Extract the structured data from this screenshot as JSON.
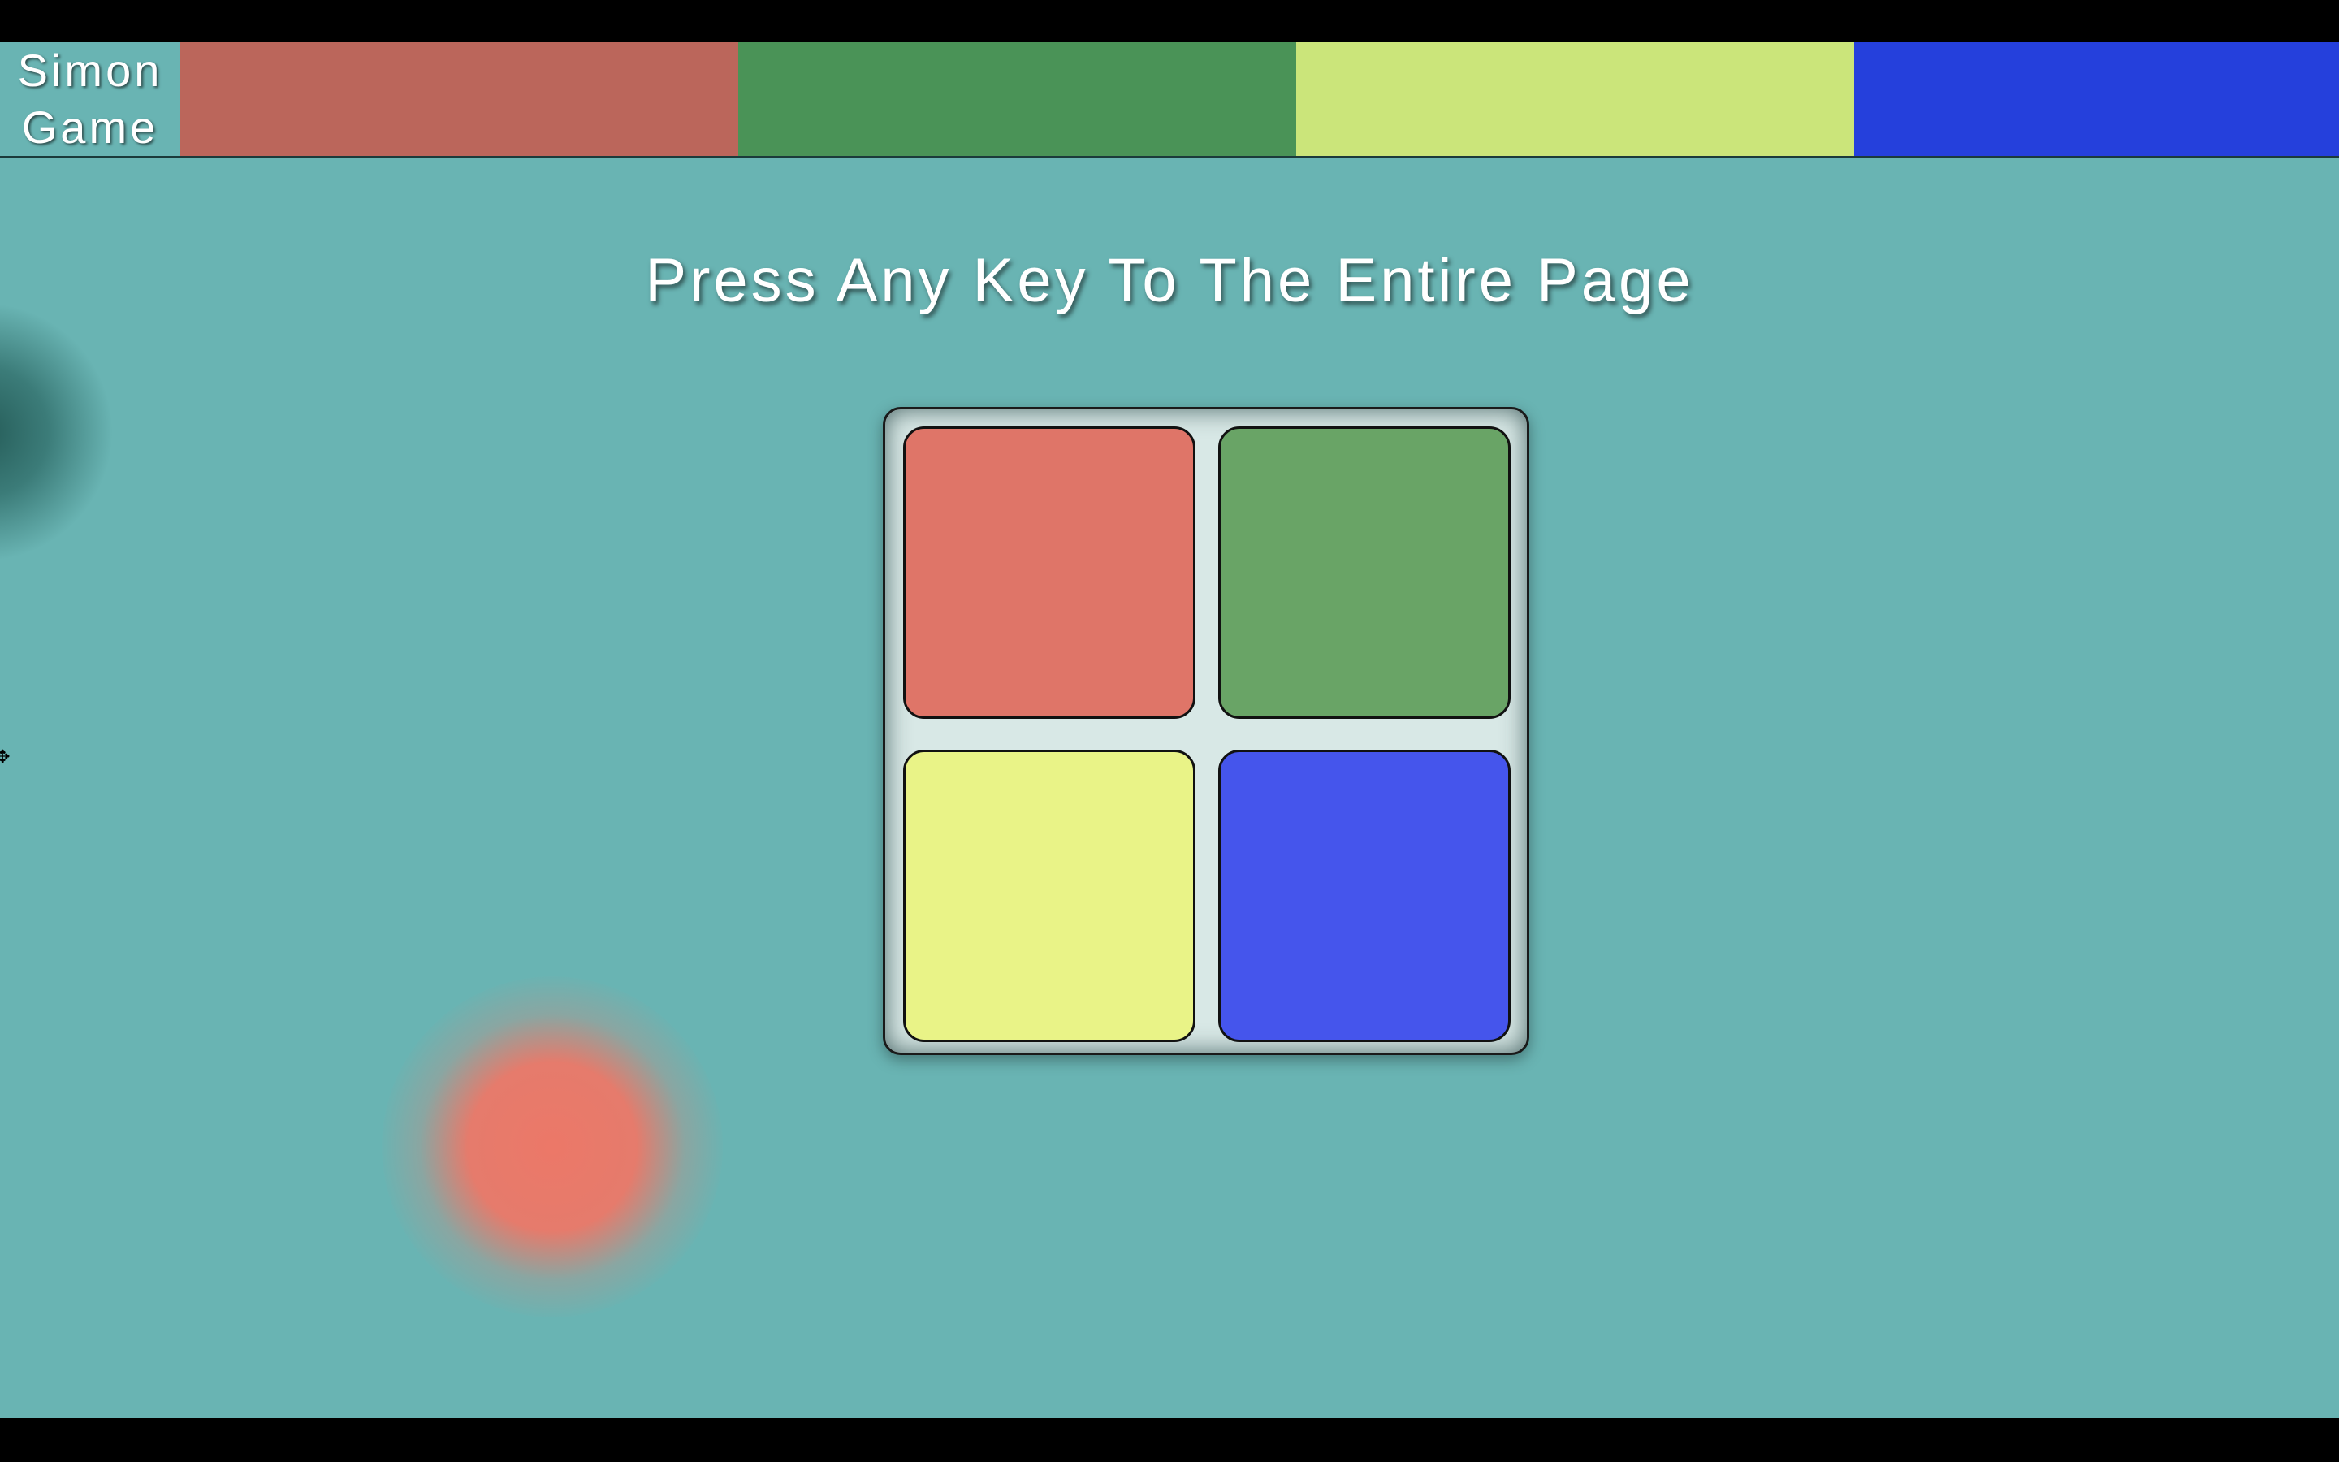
{
  "navbar": {
    "brand_line1": "Simon",
    "brand_line2": "Game",
    "swatches": [
      {
        "name": "red",
        "color": "#bb665b"
      },
      {
        "name": "green",
        "color": "#4a9357"
      },
      {
        "name": "yellow",
        "color": "#cbe57a"
      },
      {
        "name": "blue",
        "color": "#2540dc"
      }
    ]
  },
  "main": {
    "title": "Press Any Key To The Entire Page"
  },
  "board": {
    "pads": [
      {
        "name": "red",
        "color": "#df7568"
      },
      {
        "name": "green",
        "color": "#69a466"
      },
      {
        "name": "yellow",
        "color": "#e9f387"
      },
      {
        "name": "blue",
        "color": "#4555ec"
      }
    ]
  },
  "colors": {
    "background": "#69b4b3",
    "letterbox": "#000000"
  },
  "icons": {
    "cursor": "move-cursor-icon"
  }
}
